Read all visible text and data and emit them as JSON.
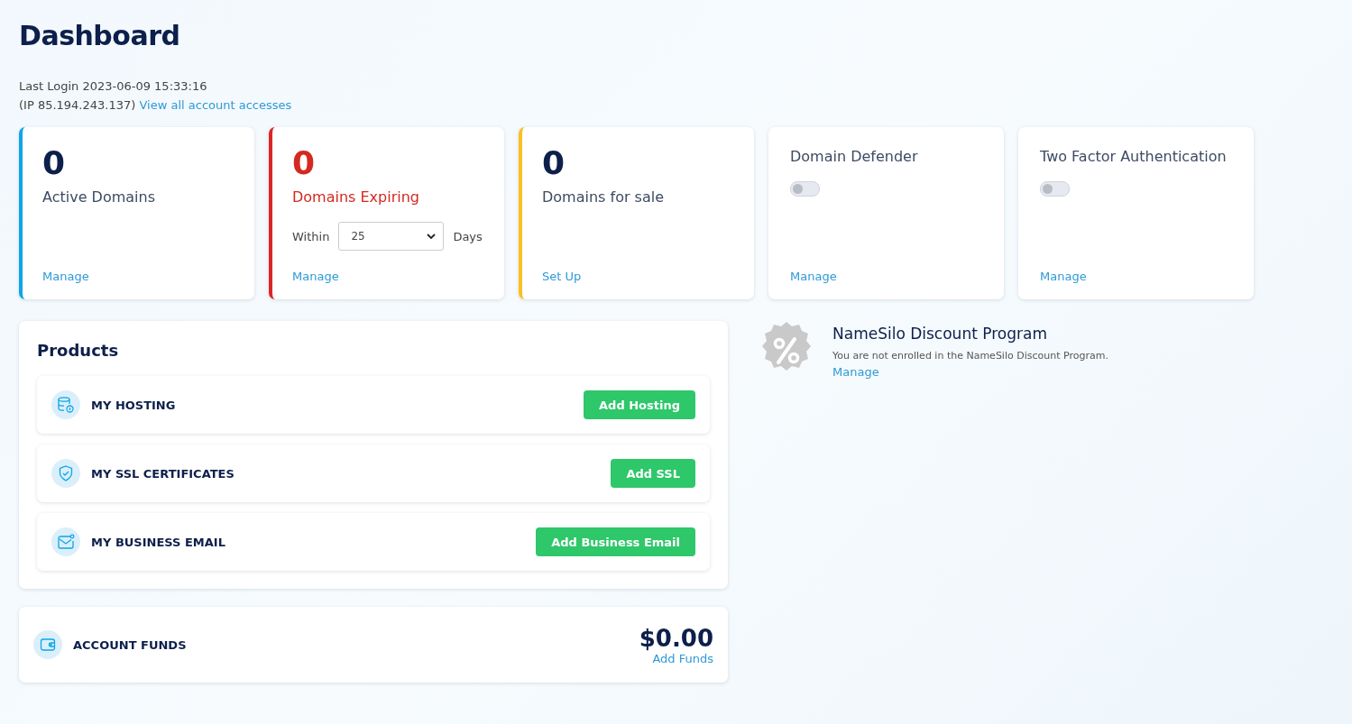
{
  "page_title": "Dashboard",
  "last_login": {
    "text": "Last Login 2023-06-09 15:33:16",
    "ip": "(IP 85.194.243.137)",
    "link": "View all account accesses"
  },
  "cards": [
    {
      "kind": "count",
      "color": "#0ea5e9",
      "value": "0",
      "label": "Active Domains",
      "alert": false,
      "link": "Manage"
    },
    {
      "kind": "count_select",
      "color": "#dc2626",
      "value": "0",
      "label": "Domains Expiring",
      "alert": true,
      "select_prefix": "Within",
      "select_value": "25",
      "select_suffix": "Days",
      "link": "Manage"
    },
    {
      "kind": "count",
      "color": "#fbbf24",
      "value": "0",
      "label": "Domains for sale",
      "alert": false,
      "link": "Set Up"
    },
    {
      "kind": "toggle",
      "label": "Domain Defender",
      "on": false,
      "link": "Manage"
    },
    {
      "kind": "toggle",
      "label": "Two Factor Authentication",
      "on": false,
      "link": "Manage"
    }
  ],
  "products": {
    "title": "Products",
    "items": [
      {
        "kind": "hosting",
        "label": "MY HOSTING",
        "button": "Add Hosting"
      },
      {
        "kind": "ssl",
        "label": "MY SSL CERTIFICATES",
        "button": "Add SSL"
      },
      {
        "kind": "email",
        "label": "MY BUSINESS EMAIL",
        "button": "Add Business Email"
      }
    ]
  },
  "funds": {
    "label": "ACCOUNT FUNDS",
    "amount": "$0.00",
    "link": "Add Funds"
  },
  "discount": {
    "title": "NameSilo Discount Program",
    "text": "You are not enrolled in the NameSilo Discount Program.",
    "link": "Manage"
  }
}
